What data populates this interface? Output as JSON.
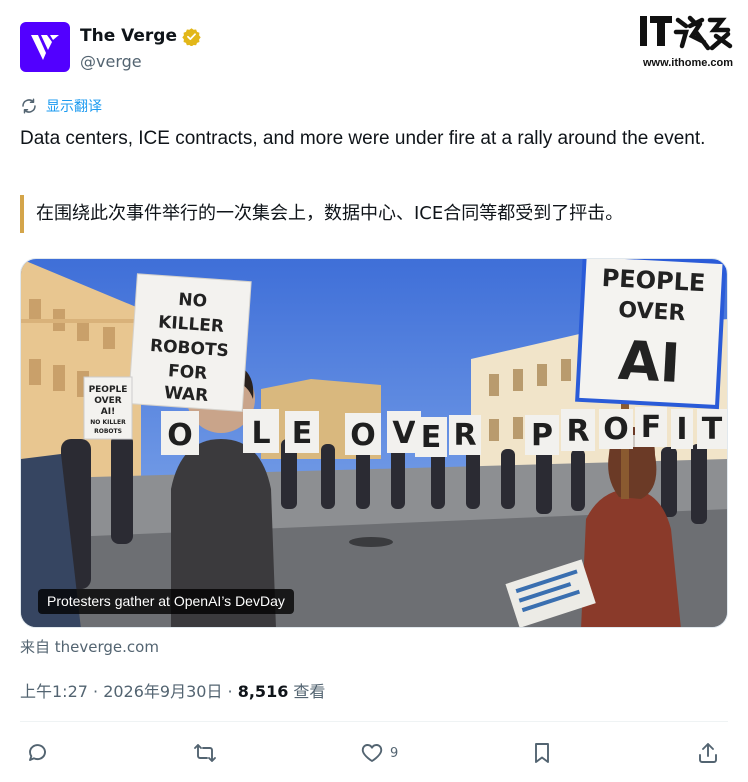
{
  "author": {
    "display_name": "The Verge",
    "handle": "@verge",
    "avatar_color": "#5200ff",
    "verified_color": "#e2b719"
  },
  "watermark": {
    "logo_text": "IT之家",
    "url": "www.ithome.com"
  },
  "translate_link": "显示翻译",
  "tweet": {
    "text": "Data centers, ICE contracts, and more were under fire at a rally around the event.",
    "translation": "在围绕此次事件举行的一次集会上，数据中心、ICE合同等都受到了抨击。"
  },
  "media": {
    "caption": "Protesters gather at OpenAI’s DevDay",
    "signs": {
      "left_big": [
        "NO",
        "KILLER",
        "ROBOTS",
        "FOR",
        "WAR"
      ],
      "left_small": [
        "PEOPLE",
        "OVER",
        "AI!",
        "NO KILLER",
        "ROBOTS"
      ],
      "right_big": [
        "PEOPLE",
        "OVER",
        "AI"
      ],
      "letters": [
        "O",
        "L",
        "E",
        "O",
        "V",
        "E",
        "R",
        "P",
        "R",
        "O",
        "F",
        "I",
        "T"
      ]
    }
  },
  "source": "来自 theverge.com",
  "meta": {
    "time": "上午1:27 · 2026年9月30日 · ",
    "views_count": "8,516",
    "views_label": " 查看"
  },
  "actions": {
    "reply_icon": "reply-icon",
    "retweet_icon": "retweet-icon",
    "like_icon": "heart-icon",
    "like_count": "9",
    "bookmark_icon": "bookmark-icon",
    "share_icon": "share-icon"
  }
}
